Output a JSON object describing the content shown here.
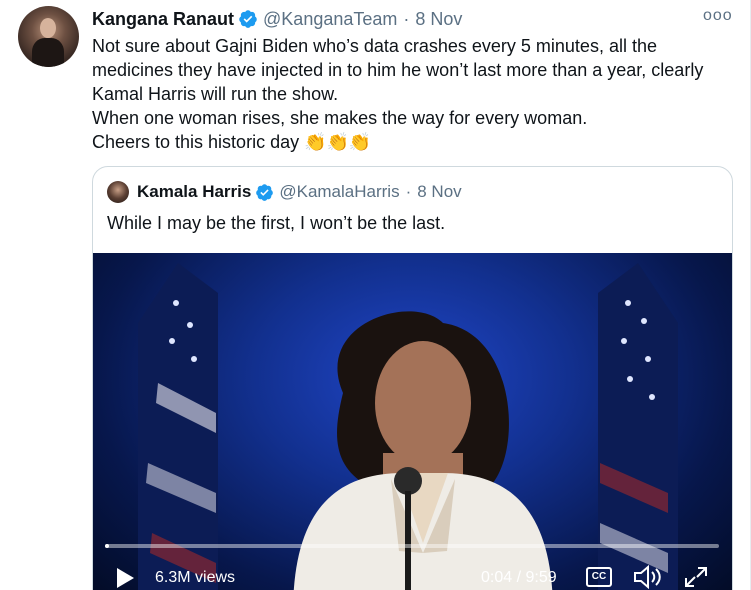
{
  "tweet": {
    "author_name": "Kangana Ranaut",
    "handle": "@KanganaTeam",
    "separator": "·",
    "date": "8 Nov",
    "more_label": "ooo",
    "lines": [
      "Not sure about Gajni Biden who’s data crashes every 5 minutes, all the",
      "medicines they have injected in to him he won’t last more than a year, clearly",
      "Kamal Harris will run the show.",
      "When one woman rises, she makes the way for every woman.",
      "Cheers to this historic day 👏👏👏"
    ]
  },
  "quoted_tweet": {
    "author_name": "Kamala Harris",
    "handle": "@KamalaHarris",
    "separator": "·",
    "date": "8 Nov",
    "text": "While I may be the first, I won’t be the last."
  },
  "video": {
    "views": "6.3M views",
    "time": "0:04 / 9:59",
    "cc_label": "CC",
    "progress": 0.007
  },
  "colors": {
    "verified": "#1d9bf0",
    "secondary_text": "#5b7083",
    "border": "#cfd9de"
  },
  "icons": [
    "verified-badge-icon",
    "more-options-icon",
    "play-icon",
    "closed-captions-icon",
    "volume-icon",
    "fullscreen-icon"
  ]
}
